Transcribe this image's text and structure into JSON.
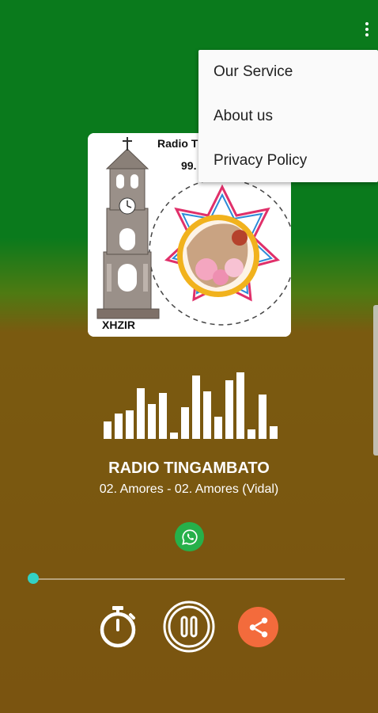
{
  "menu": {
    "items": [
      "Our Service",
      "About us",
      "Privacy Policy"
    ]
  },
  "logo": {
    "title": "Radio T",
    "frequency": "99.",
    "callsign": "XHZIR"
  },
  "player": {
    "station_name": "RADIO TINGAMBATO",
    "track": "02. Amores - 02. Amores (Vidal)",
    "progress": 0
  },
  "icons": {
    "overflow": "more-vert-icon",
    "whatsapp": "whatsapp-icon",
    "timer": "timer-icon",
    "pause": "pause-icon",
    "share": "share-icon"
  },
  "colors": {
    "top_green": "#0a7a1c",
    "bottom_brown": "#7a5410",
    "accent_teal": "#33d1c4",
    "share_orange": "#f36b3c",
    "whatsapp_green": "#26b04a"
  }
}
